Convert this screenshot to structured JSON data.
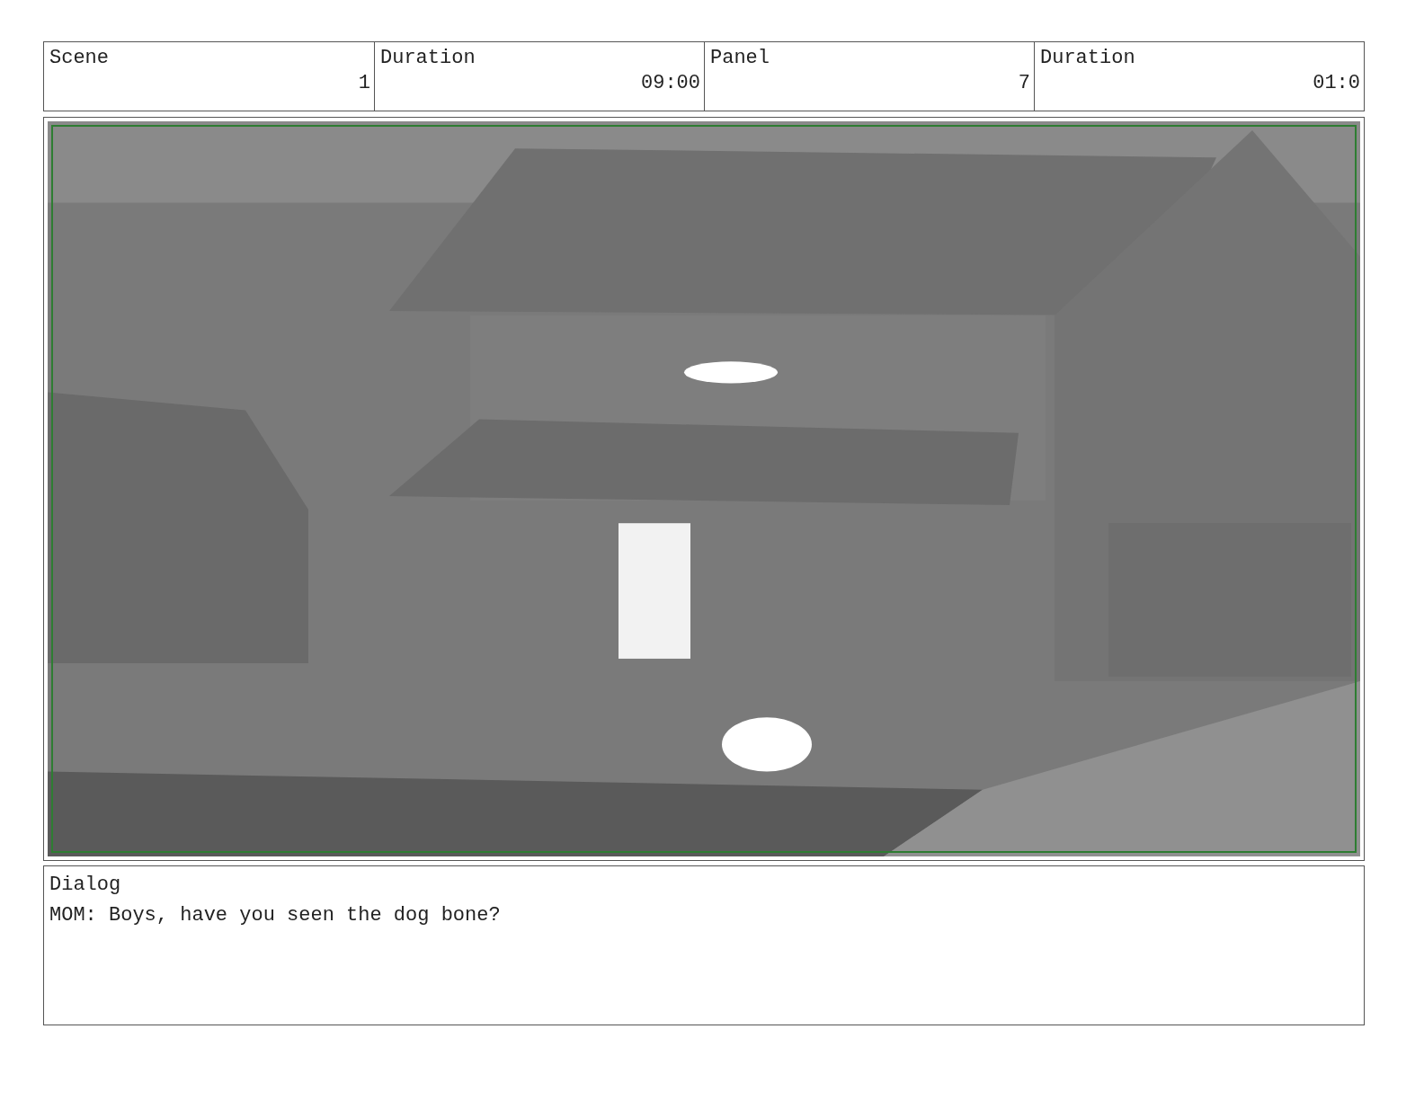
{
  "header": {
    "labels": [
      "Scene",
      "Duration",
      "Panel",
      "Duration"
    ],
    "values": [
      "1",
      "09:00",
      "7",
      "01:0"
    ]
  },
  "dialog": {
    "label": "Dialog",
    "text": "MOM: Boys, have you seen the dog bone?"
  }
}
